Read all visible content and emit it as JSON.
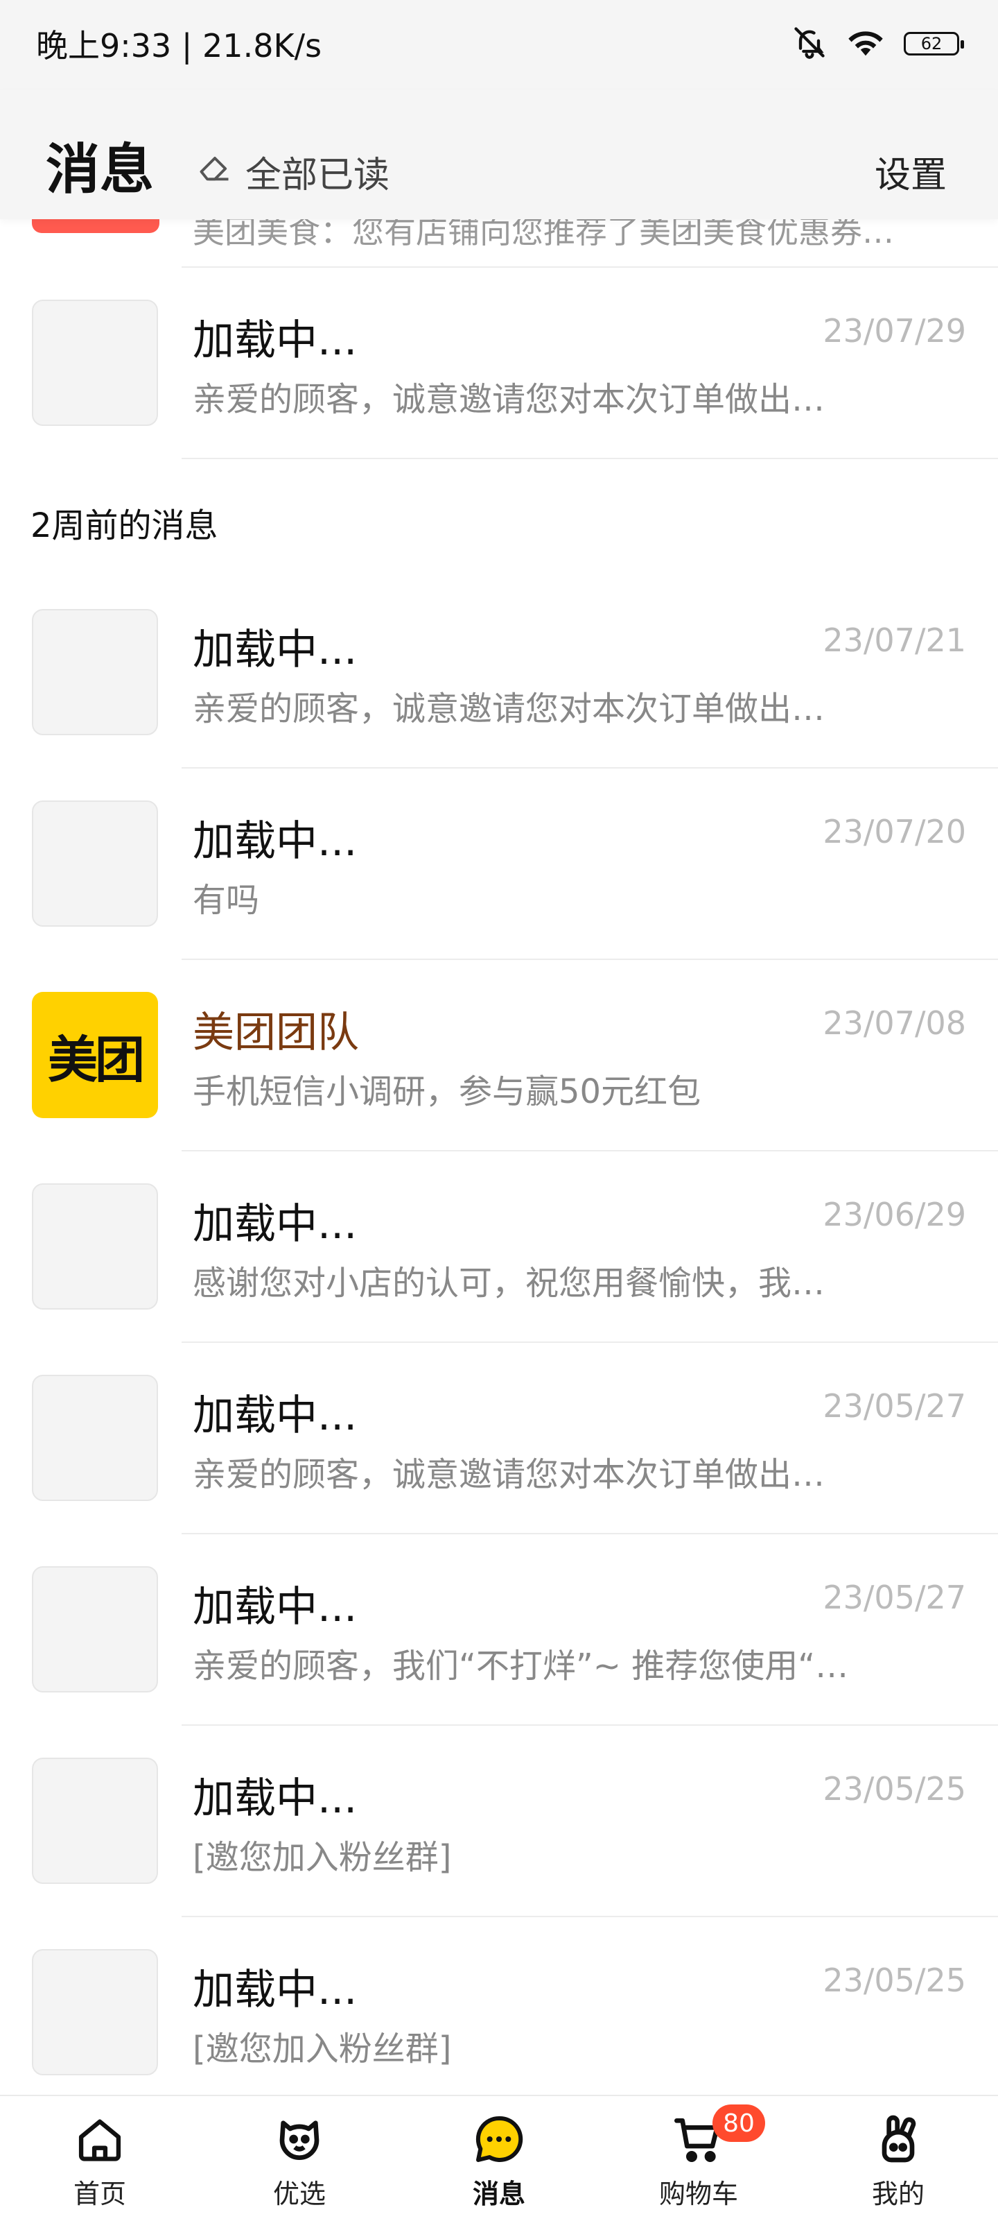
{
  "status": {
    "time": "晚上9:33 | 21.8K/s",
    "battery": "62",
    "icons": [
      "bell-muted-icon",
      "wifi-icon",
      "battery-icon"
    ]
  },
  "header": {
    "title": "消息",
    "mark_all_read": "全部已读",
    "settings": "设置",
    "icons": [
      "eraser-icon"
    ]
  },
  "partial_row": {
    "subtitle": "美团美食：您有店铺向您推荐了美团美食优惠券…"
  },
  "rows_top": [
    {
      "title": "加载中...",
      "date": "23/07/29",
      "subtitle": "亲爱的顾客，诚意邀请您对本次订单做出…"
    }
  ],
  "section": {
    "title": "2周前的消息"
  },
  "rows": [
    {
      "title": "加载中...",
      "date": "23/07/21",
      "subtitle": "亲爱的顾客，诚意邀请您对本次订单做出…"
    },
    {
      "title": "加载中...",
      "date": "23/07/20",
      "subtitle": "有吗"
    },
    {
      "title": "美团团队",
      "date": "23/07/08",
      "subtitle": "手机短信小调研，参与赢50元红包",
      "brand": "美团"
    },
    {
      "title": "加载中...",
      "date": "23/06/29",
      "subtitle": "感谢您对小店的认可，祝您用餐愉快，我…"
    },
    {
      "title": "加载中...",
      "date": "23/05/27",
      "subtitle": "亲爱的顾客，诚意邀请您对本次订单做出…"
    },
    {
      "title": "加载中...",
      "date": "23/05/27",
      "subtitle": "亲爱的顾客，我们“不打烊”~ 推荐您使用“…"
    },
    {
      "title": "加载中...",
      "date": "23/05/25",
      "subtitle": "[邀您加入粉丝群]"
    },
    {
      "title": "加载中...",
      "date": "23/05/25",
      "subtitle": "[邀您加入粉丝群]"
    }
  ],
  "nav": {
    "items": [
      {
        "label": "首页",
        "icon": "home-icon"
      },
      {
        "label": "优选",
        "icon": "youxuan-mascot-icon"
      },
      {
        "label": "消息",
        "icon": "message-bubble-icon",
        "active": true
      },
      {
        "label": "购物车",
        "icon": "cart-icon",
        "badge": "80"
      },
      {
        "label": "我的",
        "icon": "profile-rabbit-icon"
      }
    ]
  },
  "colors": {
    "brand_yellow": "#ffd100",
    "badge_red": "#ff4a2d",
    "title_orange": "#7a3a10"
  }
}
